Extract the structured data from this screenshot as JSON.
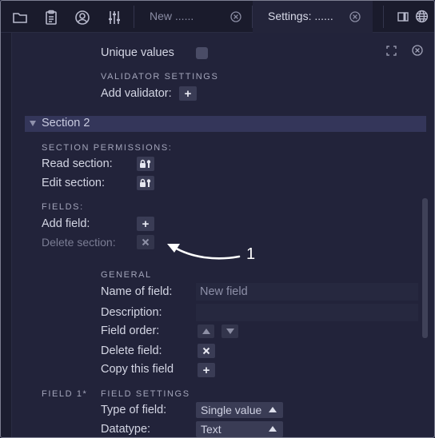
{
  "toolbar": {
    "icons": [
      "folder-icon",
      "clipboard-icon",
      "user-circle-icon",
      "sliders-icon"
    ],
    "tabs": [
      {
        "label": "New ......",
        "active": false
      },
      {
        "label": "Settings: ......",
        "active": true
      }
    ],
    "right_icons": [
      "panel-toggle-icon",
      "globe-icon"
    ]
  },
  "panel": {
    "corner_icons": [
      "expand-icon",
      "close-circle-icon"
    ],
    "unique_values_label": "Unique values",
    "validator_heading": "VALIDATOR SETTINGS",
    "add_validator_label": "Add validator:"
  },
  "section2": {
    "title": "Section 2",
    "permissions_heading": "SECTION PERMISSIONS:",
    "read_label": "Read section:",
    "edit_label": "Edit section:",
    "fields_heading": "FIELDS:",
    "add_field_label": "Add field:",
    "delete_section_label": "Delete section:"
  },
  "general": {
    "heading": "GENERAL",
    "name_label": "Name of field:",
    "name_value": "New field",
    "description_label": "Description:",
    "description_value": "",
    "order_label": "Field order:",
    "delete_label": "Delete field:",
    "copy_label": "Copy this field"
  },
  "field1": {
    "side_label": "FIELD 1*",
    "settings_heading": "FIELD SETTINGS",
    "type_label": "Type of field:",
    "type_value": "Single value",
    "datatype_label": "Datatype:",
    "datatype_value": "Text"
  },
  "annotation": {
    "number": "1"
  }
}
